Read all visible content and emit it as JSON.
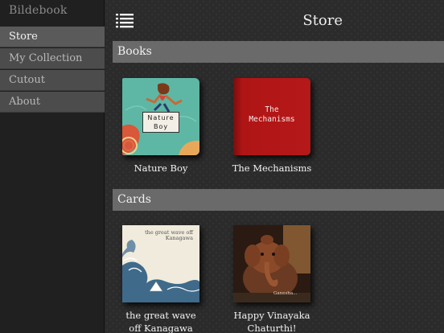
{
  "sidebar": {
    "app_title": "Bildebook",
    "items": [
      {
        "label": "Store",
        "active": true
      },
      {
        "label": "My Collection",
        "active": false
      },
      {
        "label": "Cutout",
        "active": false
      },
      {
        "label": "About",
        "active": false
      }
    ]
  },
  "header": {
    "title": "Store",
    "menu_icon": "list-menu-icon"
  },
  "sections": {
    "books": {
      "title": "Books",
      "items": [
        {
          "caption": "Nature Boy",
          "cover_text": "Nature Boy"
        },
        {
          "caption": "The Mechanisms",
          "cover_text_line1": "The",
          "cover_text_line2": "Mechanisms"
        }
      ]
    },
    "cards": {
      "title": "Cards",
      "items": [
        {
          "caption_line1": "the great wave",
          "caption_line2": "off Kanagawa",
          "cover_text_line1": "the great wave off",
          "cover_text_line2": "Kanagawa"
        },
        {
          "caption_line1": "Happy Vinayaka",
          "caption_line2": "Chaturthi!",
          "cover_text": "Ganesha..."
        }
      ]
    }
  },
  "colors": {
    "sidebar_bg": "#202020",
    "nav_item_bg": "#4c4c4c",
    "section_header_bg": "#6a6a6a",
    "main_bg": "#2b2b2b"
  }
}
